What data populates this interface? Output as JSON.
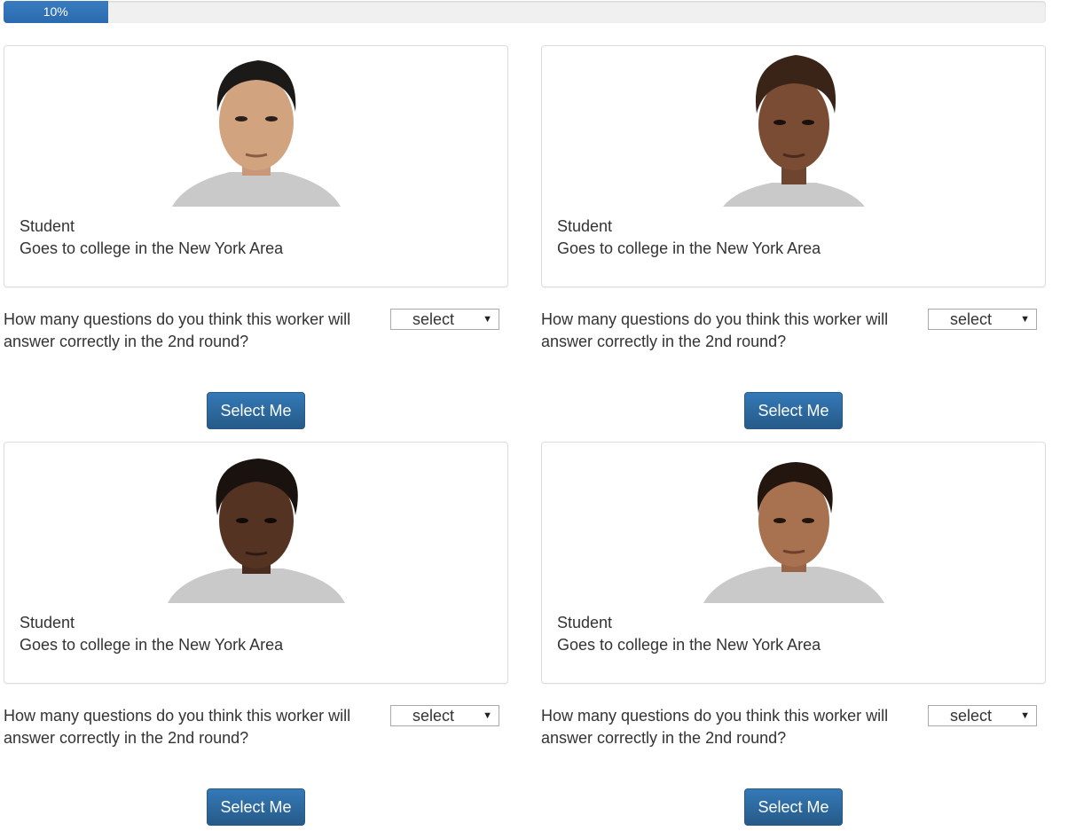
{
  "progress": {
    "label": "10%",
    "percent": 10
  },
  "workers": [
    {
      "role": "Student",
      "description": "Goes to college in the New York Area",
      "question": "How many questions do you think this worker will answer correctly in the 2nd round?",
      "select_value": "select",
      "button_label": "Select Me"
    },
    {
      "role": "Student",
      "description": "Goes to college in the New York Area",
      "question": "How many questions do you think this worker will answer correctly in the 2nd round?",
      "select_value": "select",
      "button_label": "Select Me"
    },
    {
      "role": "Student",
      "description": "Goes to college in the New York Area",
      "question": "How many questions do you think this worker will answer correctly in the 2nd round?",
      "select_value": "select",
      "button_label": "Select Me"
    },
    {
      "role": "Student",
      "description": "Goes to college in the New York Area",
      "question": "How many questions do you think this worker will answer correctly in the 2nd round?",
      "select_value": "select",
      "button_label": "Select Me"
    }
  ],
  "colors": {
    "primary_button": "#2f6fa8",
    "progress_fill": "#337ab7",
    "card_border": "#dddddd"
  },
  "icons": {
    "dropdown": "triangle-down-icon"
  }
}
